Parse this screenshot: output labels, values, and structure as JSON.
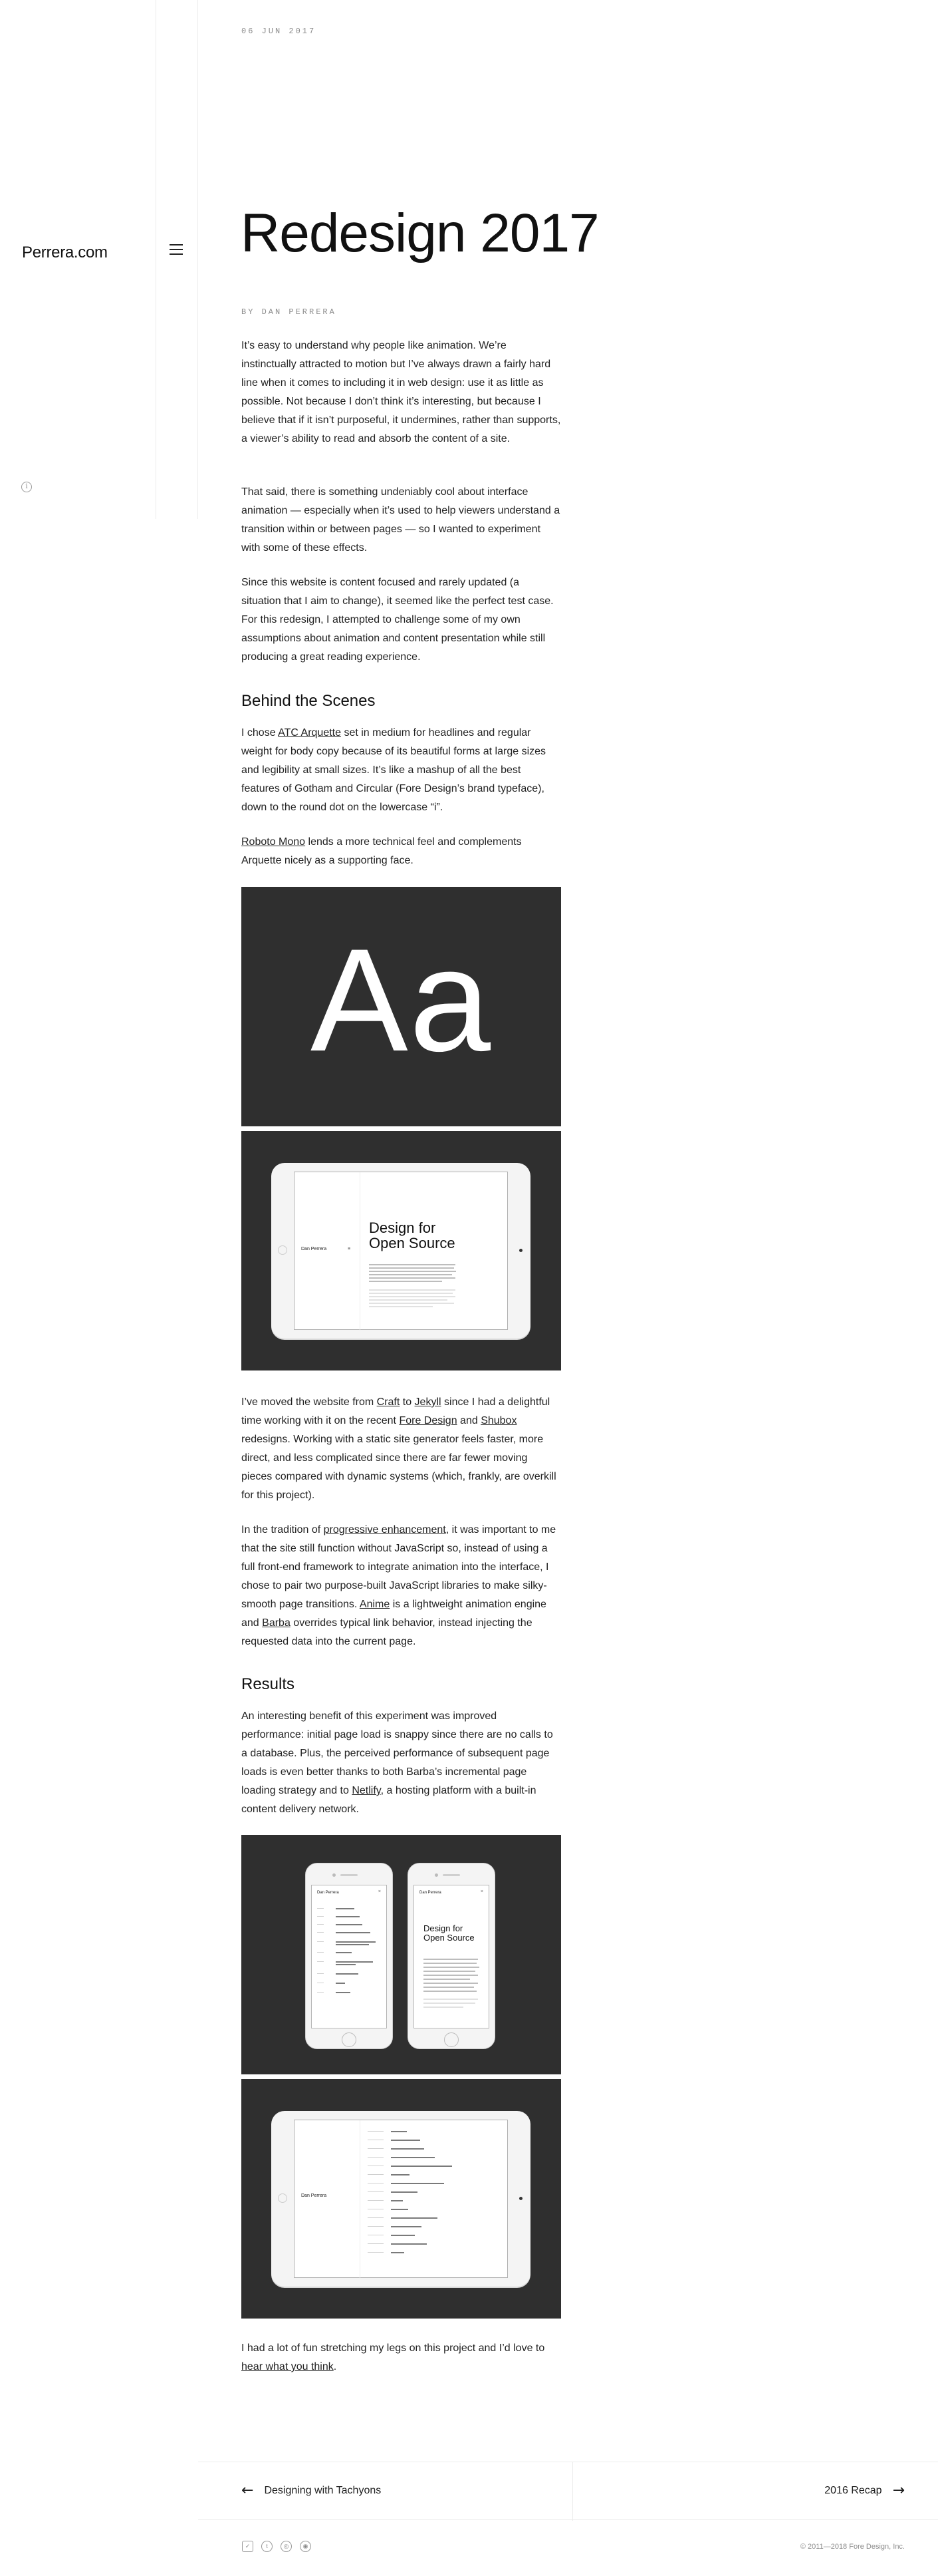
{
  "site": {
    "brand": "Perrera.com"
  },
  "icons": {
    "menu": "hamburger-icon",
    "info": "info-icon"
  },
  "post": {
    "date": "06 JUN 2017",
    "title": "Redesign 2017",
    "byline": "BY DAN PERRERA"
  },
  "body": {
    "p1": "It’s easy to understand why people like animation. We’re instinctually attracted to motion but I’ve always drawn a fairly hard line when it comes to including it in web design: use it as little as possible. Not because I don’t think it’s interesting, but because I believe that if it isn’t purposeful, it undermines, rather than supports, a viewer’s ability to read and absorb the content of a site.",
    "p2": "That said, there is something undeniably cool about interface animation — especially when it’s used to help viewers understand a transition within or between pages — so I wanted to experiment with some of these effects.",
    "p3": "Since this website is content focused and rarely updated (a situation that I aim to change), it seemed like the perfect test case. For this redesign, I attempted to challenge some of my own assumptions about animation and content presentation while still producing a great reading experience.",
    "h_scenes": "Behind the Scenes",
    "p4_a": "I chose ",
    "p4_link": "ATC Arquette",
    "p4_b": " set in medium for headlines and regular weight for body copy because of its beautiful forms at large sizes and legibility at small sizes. It’s like a mashup of all the best features of Gotham and Circular (Fore Design’s brand typeface), down to the round dot on the lowercase “i”.",
    "p5_link": "Roboto Mono",
    "p5_b": " lends a more technical feel and complements Arquette nicely as a supporting face.",
    "fig1_glyph": "Aa",
    "fig2_brand": "Dan Perrera",
    "fig2_title": "Design for Open Source",
    "p6_a": "I’ve moved the website from ",
    "p6_l1": "Craft",
    "p6_b": " to ",
    "p6_l2": "Jekyll",
    "p6_c": " since I had a delightful time working with it on the recent ",
    "p6_l3": "Fore Design",
    "p6_d": " and ",
    "p6_l4": "Shubox",
    "p6_e": " redesigns. Working with a static site generator feels faster, more direct, and less complicated since there are far fewer moving pieces compared with dynamic systems (which, frankly, are overkill for this project).",
    "p7_a": "In the tradition of ",
    "p7_l1": "progressive enhancement",
    "p7_b": ", it was important to me that the site still function without JavaScript so, instead of using a full front-end framework to integrate animation into the interface, I chose to pair two purpose-built JavaScript libraries to make silky-smooth page transitions. ",
    "p7_l2": "Anime",
    "p7_c": " is a lightweight animation engine and ",
    "p7_l3": "Barba",
    "p7_d": " overrides typical link behavior, instead injecting the requested data into the current page.",
    "h_results": "Results",
    "p8_a": "An interesting benefit of this experiment was improved performance: initial page load is snappy since there are no calls to a database. Plus, the perceived performance of subsequent page loads is even better thanks to both Barba’s incremental page loading strategy and to ",
    "p8_link": "Netlify",
    "p8_b": ", a hosting platform with a built-in content delivery network.",
    "fig3_brand": "Dan Perrera",
    "fig3_title": "Design for Open Source",
    "fig4_brand": "Dan Perrera",
    "p9_a": "I had a lot of fun stretching my legs on this project and I’d love to ",
    "p9_link": "hear what you think",
    "p9_b": "."
  },
  "postnav": {
    "prev": "Designing with Tachyons",
    "next": "2016 Recap",
    "prev_arrow": "←",
    "next_arrow": "→"
  },
  "footer": {
    "social": [
      "dribbble-icon",
      "twitter-icon",
      "instagram-icon",
      "github-icon"
    ],
    "copyright": "© 2011—2018 Fore Design, Inc."
  }
}
